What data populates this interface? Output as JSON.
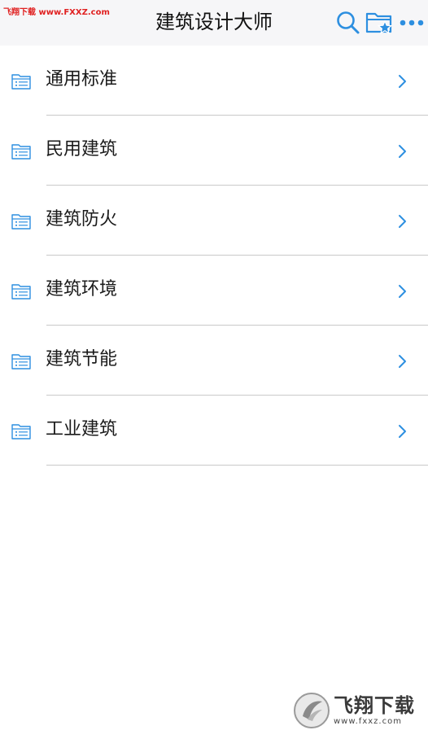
{
  "watermark": {
    "top_text": "飞翔下载 www.FXXZ.com",
    "badge_cn": "飞翔下载",
    "badge_url": "www.fxxz.com"
  },
  "header": {
    "title": "建筑设计大师",
    "icons": [
      "search-icon",
      "favorite-folder-icon",
      "more-icon"
    ]
  },
  "colors": {
    "accent": "#2d8fe0",
    "header_bg": "#f6f6f8",
    "divider": "#c9c9c9",
    "text": "#1a1a1a"
  },
  "categories": [
    {
      "label": "通用标准"
    },
    {
      "label": "民用建筑"
    },
    {
      "label": "建筑防火"
    },
    {
      "label": "建筑环境"
    },
    {
      "label": "建筑节能"
    },
    {
      "label": "工业建筑"
    }
  ]
}
